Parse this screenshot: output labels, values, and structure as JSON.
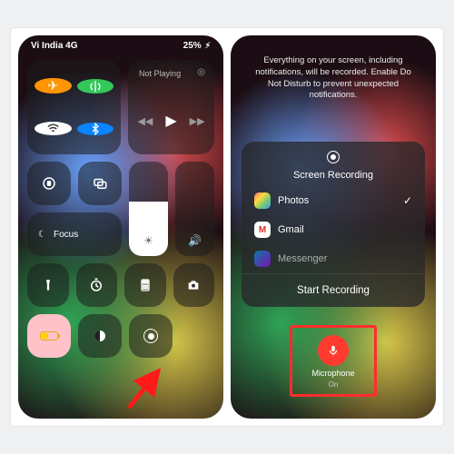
{
  "left": {
    "status": {
      "carrier": "Vi India 4G",
      "battery_pct": "25%"
    },
    "connectivity": {
      "airplane": "airplane",
      "cell": "antenna",
      "wifi": "wifi",
      "bt": "bluetooth"
    },
    "media": {
      "title": "Not Playing"
    },
    "focus_label": "Focus",
    "tiles": {
      "lock": "rotation-lock",
      "mirror": "screen-mirror",
      "moon": "focus-moon",
      "torch": "flashlight",
      "timer": "timer",
      "calc": "calculator",
      "camera": "camera",
      "low_power": "low-power",
      "dark": "dark-mode",
      "record": "screen-record"
    }
  },
  "right": {
    "disclaimer": "Everything on your screen, including notifications, will be recorded. Enable Do Not Disturb to prevent unexpected notifications.",
    "sheet": {
      "title": "Screen Recording",
      "options": [
        {
          "name": "Photos",
          "selected": true,
          "color": "#fff"
        },
        {
          "name": "Gmail",
          "selected": false,
          "color": "#fff"
        },
        {
          "name": "Messenger",
          "selected": false,
          "color": "#fff"
        }
      ],
      "start": "Start Recording"
    },
    "mic": {
      "label": "Microphone",
      "state": "On"
    }
  }
}
